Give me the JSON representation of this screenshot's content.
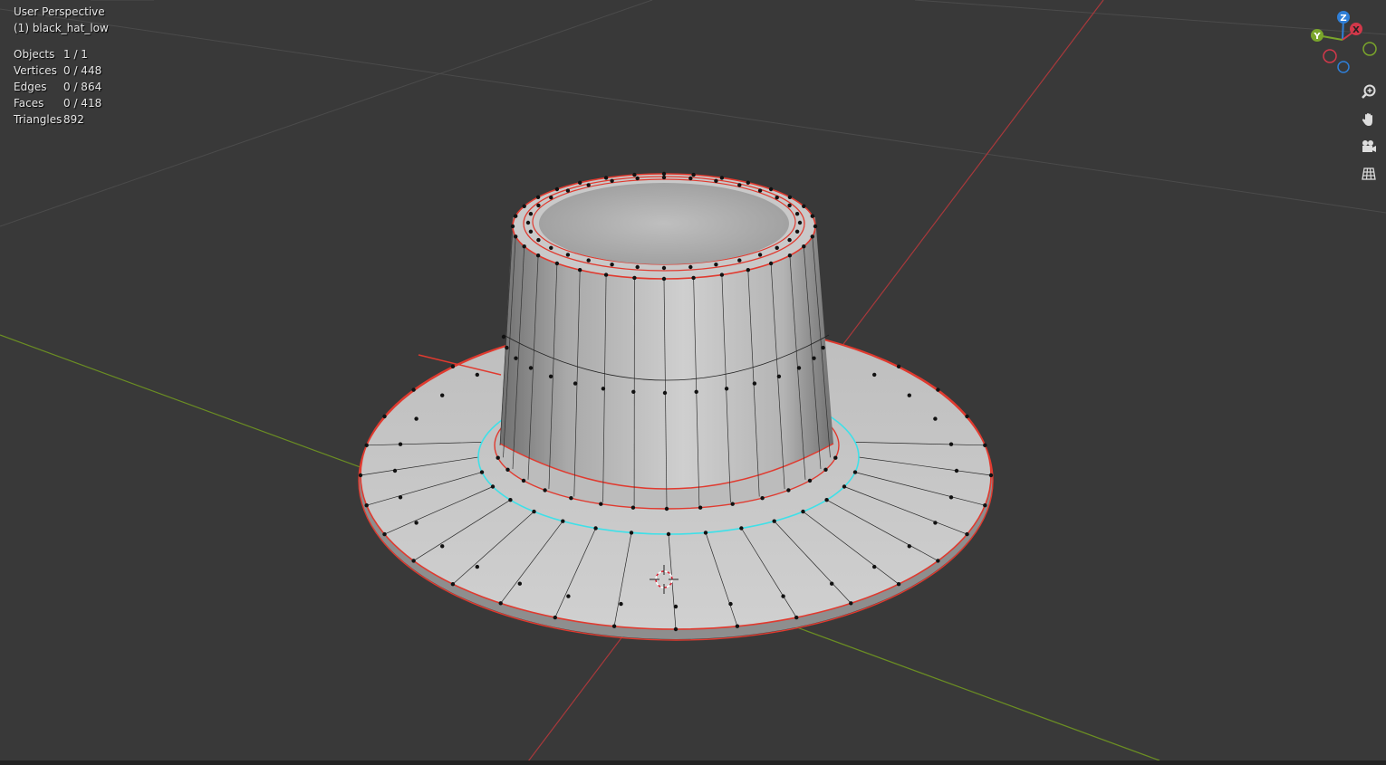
{
  "viewport": {
    "view_title": "User Perspective",
    "object_name": "(1) black_hat_low"
  },
  "stats": [
    {
      "label": "Objects",
      "value": "1 / 1"
    },
    {
      "label": "Vertices",
      "value": "0 / 448"
    },
    {
      "label": "Edges",
      "value": "0 / 864"
    },
    {
      "label": "Faces",
      "value": "0 / 418"
    },
    {
      "label": "Triangles",
      "value": "892"
    }
  ],
  "gizmo": {
    "z_label": "Z",
    "y_label": "Y",
    "x_label": "X",
    "colors": {
      "x": "#d2384a",
      "y": "#7aa52b",
      "z": "#2f7fd8"
    }
  },
  "nav_buttons": {
    "zoom": "zoom-icon",
    "pan": "hand-icon",
    "camera": "camera-icon",
    "ortho": "grid-icon"
  },
  "colors": {
    "background": "#393939",
    "grid": "#4a4a4a",
    "x_axis": "#b0393b",
    "y_axis": "#6b8e23",
    "seam": "#e03a2f",
    "selected_edge": "#3fe0e8",
    "mesh_light": "#c6c6c6",
    "mesh_dark": "#7d7d7d"
  }
}
